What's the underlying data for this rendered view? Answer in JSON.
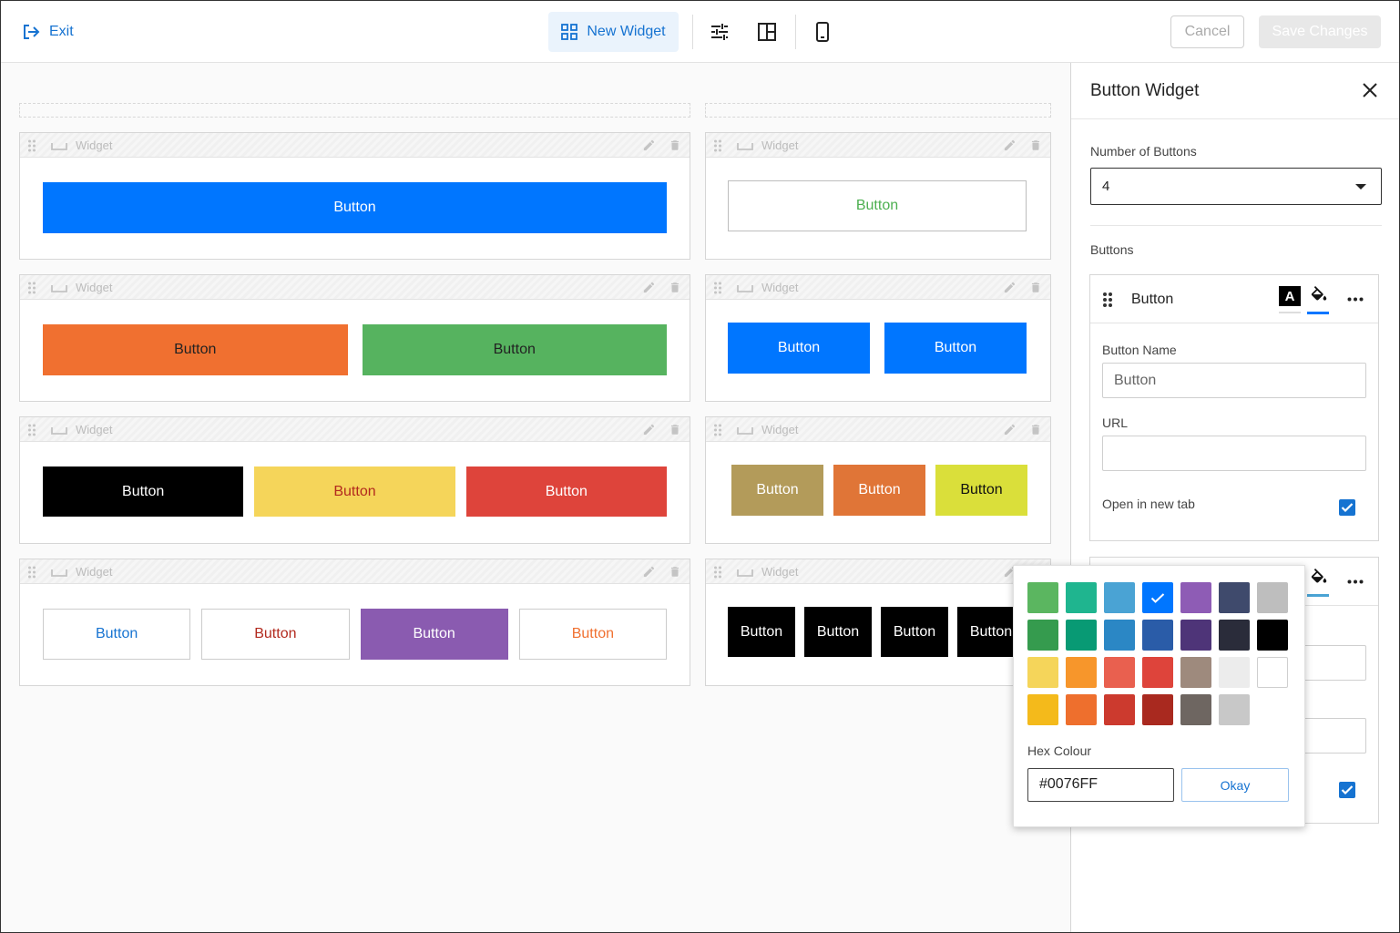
{
  "topbar": {
    "exit_label": "Exit",
    "new_widget_label": "New Widget",
    "cancel_label": "Cancel",
    "save_label": "Save Changes"
  },
  "widget_title": "Widget",
  "widget_rows": [
    {
      "left": [
        {
          "label": "Button",
          "bg": "#0076FF",
          "fg": "#ffffff"
        }
      ],
      "right": [
        {
          "label": "Button",
          "bg": "#ffffff",
          "fg": "#4caf50",
          "border": "#bdbdbd"
        }
      ]
    },
    {
      "left": [
        {
          "label": "Button",
          "bg": "#F07030",
          "fg": "#222222"
        },
        {
          "label": "Button",
          "bg": "#56B35F",
          "fg": "#222222"
        }
      ],
      "right": [
        {
          "label": "Button",
          "bg": "#0076FF",
          "fg": "#ffffff"
        },
        {
          "label": "Button",
          "bg": "#0076FF",
          "fg": "#ffffff"
        }
      ]
    },
    {
      "left": [
        {
          "label": "Button",
          "bg": "#000000",
          "fg": "#ffffff"
        },
        {
          "label": "Button",
          "bg": "#F5D55A",
          "fg": "#B22A1E"
        },
        {
          "label": "Button",
          "bg": "#DE443B",
          "fg": "#ffffff"
        }
      ],
      "right": [
        {
          "label": "Button",
          "bg": "#B39B5A",
          "fg": "#ffffff"
        },
        {
          "label": "Button",
          "bg": "#E07537",
          "fg": "#ffffff"
        },
        {
          "label": "Button",
          "bg": "#DADF3A",
          "fg": "#111111"
        }
      ]
    },
    {
      "left": [
        {
          "label": "Button",
          "bg": "#ffffff",
          "fg": "#1673d1",
          "border": "#cccccc"
        },
        {
          "label": "Button",
          "bg": "#ffffff",
          "fg": "#B22A1E",
          "border": "#cccccc"
        },
        {
          "label": "Button",
          "bg": "#8A5BB0",
          "fg": "#ffffff"
        },
        {
          "label": "Button",
          "bg": "#ffffff",
          "fg": "#F07030",
          "border": "#cccccc"
        }
      ],
      "right": [
        {
          "label": "Button",
          "bg": "#000000",
          "fg": "#ffffff"
        },
        {
          "label": "Button",
          "bg": "#000000",
          "fg": "#ffffff"
        },
        {
          "label": "Button",
          "bg": "#000000",
          "fg": "#ffffff"
        },
        {
          "label": "Button",
          "bg": "#000000",
          "fg": "#ffffff"
        }
      ]
    }
  ],
  "panel": {
    "title": "Button Widget",
    "number_label": "Number of Buttons",
    "number_value": "4",
    "buttons_label": "Buttons",
    "card": {
      "title": "Button",
      "name_label": "Button Name",
      "name_value": "Button",
      "url_label": "URL",
      "url_value": "",
      "new_tab_label": "Open in new tab",
      "new_tab_checked": true
    }
  },
  "color_picker": {
    "swatches": [
      [
        "#5BB660",
        "#1FB58F",
        "#4AA3D4",
        "#0076FF",
        "#8E5CB5",
        "#3F4A6C",
        "#BEBEBE"
      ],
      [
        "#359B4E",
        "#089A74",
        "#2B87C5",
        "#2A5CA8",
        "#4E3478",
        "#2A2C3A",
        "#000000"
      ],
      [
        "#F5D55A",
        "#F7962B",
        "#E9604F",
        "#DE443B",
        "#9E8A7D",
        "#ECECEC",
        "#FFFFFF"
      ],
      [
        "#F4BA1B",
        "#EE6F2D",
        "#CC3A2E",
        "#A9291F",
        "#6E6661",
        "#C8C8C8"
      ]
    ],
    "selected": "#0076FF",
    "hex_label": "Hex Colour",
    "hex_value": "#0076FF",
    "okay_label": "Okay"
  }
}
